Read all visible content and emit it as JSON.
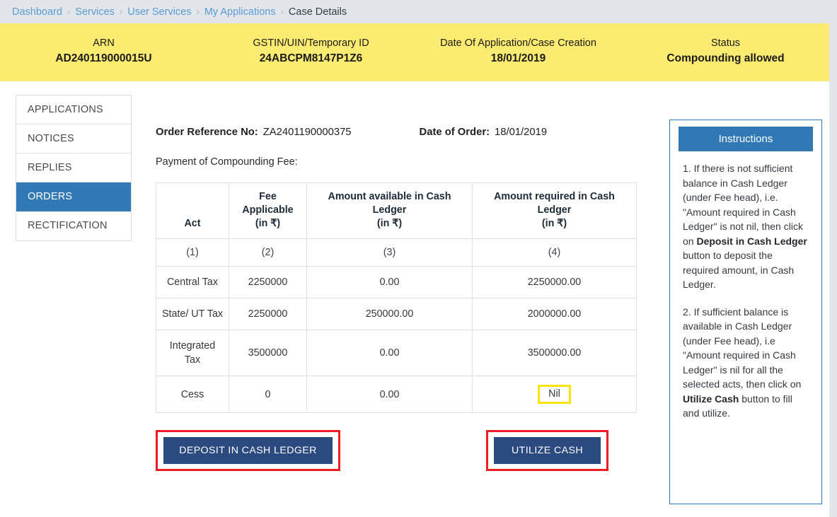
{
  "breadcrumb": {
    "separator": "›",
    "links": [
      "Dashboard",
      "Services",
      "User Services",
      "My Applications"
    ],
    "current": "Case Details"
  },
  "case_banner": [
    {
      "label": "ARN",
      "value": "AD240119000015U"
    },
    {
      "label": "GSTIN/UIN/Temporary ID",
      "value": "24ABCPM8147P1Z6"
    },
    {
      "label": "Date Of Application/Case Creation",
      "value": "18/01/2019"
    },
    {
      "label": "Status",
      "value": "Compounding allowed"
    }
  ],
  "sidebar": {
    "items": [
      {
        "label": "APPLICATIONS",
        "active": false
      },
      {
        "label": "NOTICES",
        "active": false
      },
      {
        "label": "REPLIES",
        "active": false
      },
      {
        "label": "ORDERS",
        "active": true
      },
      {
        "label": "RECTIFICATION",
        "active": false
      }
    ]
  },
  "order": {
    "ref_label": "Order Reference No:",
    "ref_value": "ZA2401190000375",
    "date_label": "Date of Order:",
    "date_value": "18/01/2019",
    "fee_caption": "Payment of Compounding Fee:"
  },
  "fee_table": {
    "headers": [
      "Act",
      "Fee Applicable (in ₹)",
      "Amount available in Cash Ledger (in ₹)",
      "Amount required in Cash Ledger (in ₹)"
    ],
    "headers_split": [
      {
        "line1": "",
        "line2": "",
        "line3": "Act"
      },
      {
        "line1": "Fee",
        "line2": "Applicable",
        "line3": "(in ₹)"
      },
      {
        "line1": "Amount available in Cash",
        "line2": "Ledger",
        "line3": "(in ₹)"
      },
      {
        "line1": "Amount required in Cash",
        "line2": "Ledger",
        "line3": "(in ₹)"
      }
    ],
    "column_numbers": [
      "(1)",
      "(2)",
      "(3)",
      "(4)"
    ],
    "rows": [
      {
        "act": "Central Tax",
        "fee": "2250000",
        "available": "0.00",
        "required": "2250000.00",
        "highlight": false
      },
      {
        "act": "State/ UT Tax",
        "fee": "2250000",
        "available": "250000.00",
        "required": "2000000.00",
        "highlight": false
      },
      {
        "act": "Integrated Tax",
        "fee": "3500000",
        "available": "0.00",
        "required": "3500000.00",
        "highlight": false
      },
      {
        "act": "Cess",
        "fee": "0",
        "available": "0.00",
        "required": "Nil",
        "highlight": true
      }
    ]
  },
  "buttons": {
    "deposit_label": "DEPOSIT IN CASH LEDGER",
    "utilize_label": "UTILIZE CASH"
  },
  "instructions": {
    "title": "Instructions",
    "paragraph_1_pre": "1. If there is not sufficient balance in Cash Ledger (under Fee head), i.e. \"Amount required in Cash Ledger\" is not nil, then click on ",
    "paragraph_1_bold": "Deposit in Cash Ledger",
    "paragraph_1_post": " button to deposit the required amount, in Cash Ledger.",
    "paragraph_2_pre": "2. If sufficient balance is available in Cash Ledger (under Fee head), i.e \"Amount required in Cash Ledger\" is nil for all the selected acts, then click on ",
    "paragraph_2_bold": "Utilize Cash",
    "paragraph_2_post": " button to fill and utilize."
  },
  "colors": {
    "banner_yellow": "#fceb71",
    "breadcrumb_bg": "#e2e6ea",
    "accent_blue": "#3179b5",
    "button_navy": "#2b4b80",
    "annotation_red": "#ee1c25",
    "highlight_yellow": "#ffe400",
    "link_blue": "#5a9bd4"
  }
}
